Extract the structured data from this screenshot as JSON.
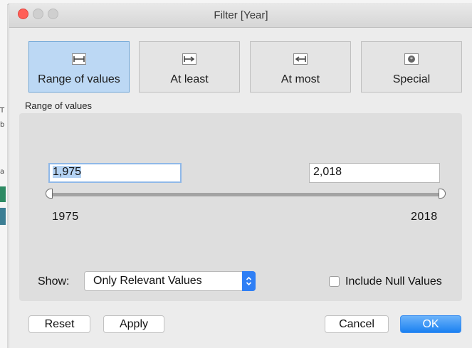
{
  "window": {
    "title": "Filter [Year]"
  },
  "modes": {
    "range": "Range of values",
    "at_least": "At least",
    "at_most": "At most",
    "special": "Special"
  },
  "section_label": "Range of values",
  "range": {
    "min_input": "1,975",
    "max_input": "2,018",
    "min_label": "1975",
    "max_label": "2018"
  },
  "show": {
    "label": "Show:",
    "selected": "Only Relevant Values"
  },
  "include_null": {
    "label": "Include Null Values",
    "checked": false
  },
  "buttons": {
    "reset": "Reset",
    "apply": "Apply",
    "cancel": "Cancel",
    "ok": "OK"
  },
  "colors": {
    "selected_tile": "#bcd8f4",
    "accent": "#1b81f1",
    "close": "#ff5f57"
  },
  "icons": [
    "range-icon",
    "at-least-icon",
    "at-most-icon",
    "special-icon",
    "select-arrows-icon"
  ]
}
